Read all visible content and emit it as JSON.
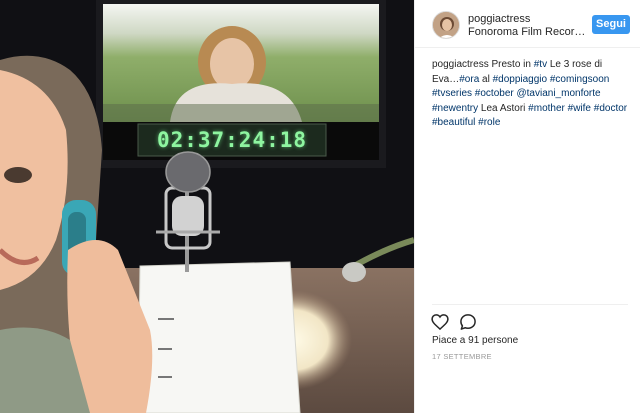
{
  "post": {
    "timecode": "02:37:24:18"
  },
  "header": {
    "username": "poggiactress",
    "location": "Fonoroma Film Recor…",
    "follow_label": "Segui"
  },
  "caption": {
    "username": "poggiactress",
    "parts": [
      {
        "t": " Presto in ",
        "tag": false
      },
      {
        "t": "#tv",
        "tag": true
      },
      {
        "t": " Le 3 rose di Eva…",
        "tag": false
      },
      {
        "t": "#ora",
        "tag": true
      },
      {
        "t": " al ",
        "tag": false
      },
      {
        "t": "#doppiaggio",
        "tag": true
      },
      {
        "t": " ",
        "tag": false
      },
      {
        "t": "#comingsoon",
        "tag": true
      },
      {
        "t": " ",
        "tag": false
      },
      {
        "t": "#tvseries",
        "tag": true
      },
      {
        "t": " ",
        "tag": false
      },
      {
        "t": "#october",
        "tag": true
      },
      {
        "t": " ",
        "tag": false
      },
      {
        "t": "@taviani_monforte",
        "tag": true
      },
      {
        "t": " ",
        "tag": false
      },
      {
        "t": "#newentry",
        "tag": true
      },
      {
        "t": " Lea Astori ",
        "tag": false
      },
      {
        "t": "#mother",
        "tag": true
      },
      {
        "t": " ",
        "tag": false
      },
      {
        "t": "#wife",
        "tag": true
      },
      {
        "t": " ",
        "tag": false
      },
      {
        "t": "#doctor",
        "tag": true
      },
      {
        "t": " ",
        "tag": false
      },
      {
        "t": "#beautiful",
        "tag": true
      },
      {
        "t": " ",
        "tag": false
      },
      {
        "t": "#role",
        "tag": true
      }
    ]
  },
  "engagement": {
    "likes_label": "Piace a 91 persone",
    "date_label": "17 SETTEMBRE"
  },
  "icons": {
    "like": "heart-icon",
    "comment": "comment-icon"
  },
  "colors": {
    "follow_button": "#3897f0",
    "hashtag": "#003569",
    "timecode": "#8ef5a0"
  }
}
